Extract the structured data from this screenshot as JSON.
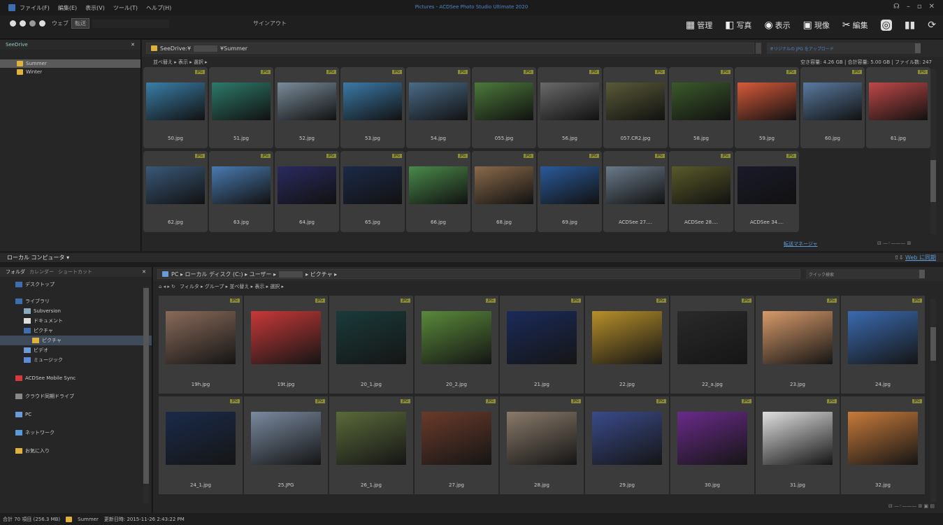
{
  "menu": [
    "ファイル(F)",
    "編集(E)",
    "表示(V)",
    "ツール(T)",
    "ヘルプ(H)"
  ],
  "window_title": "Pictures - ACDSee Photo Studio Ultimate 2020",
  "toolbar": {
    "web": "ウェブ",
    "transfer": "転送",
    "signout": "サインアウト"
  },
  "modes": [
    {
      "label": "管理",
      "icon": "▦"
    },
    {
      "label": "写真",
      "icon": "◧"
    },
    {
      "label": "表示",
      "icon": "◉"
    },
    {
      "label": "現像",
      "icon": "▣"
    },
    {
      "label": "編集",
      "icon": "✂"
    }
  ],
  "top": {
    "panel_title": "SeeDrive",
    "tree": [
      {
        "label": "Summer"
      },
      {
        "label": "Winter"
      }
    ],
    "path_prefix": "SeeDrive:¥",
    "path_suffix": "¥Summer",
    "search_placeholder": "オリジナルの JPG をアップロード",
    "filters": "並べ替え ▸  表示 ▸  選択 ▸",
    "stats": "空き容量: 4.26 GB  |  合計容量: 5.00 GB  |  ファイル数: 247",
    "transfer_manager": "転送マネージャ",
    "files": [
      "50.jpg",
      "51.jpg",
      "52.jpg",
      "53.jpg",
      "54.jpg",
      "055.jpg",
      "56.jpg",
      "057.CR2.jpg",
      "58.jpg",
      "59.jpg",
      "60.jpg",
      "61.jpg",
      "62.jpg",
      "63.jpg",
      "64.jpg",
      "65.jpg",
      "66.jpg",
      "68.jpg",
      "69.jpg",
      "ACDSee 27....",
      "ACDSee 28....",
      "ACDSee 34...."
    ],
    "colors": [
      "#3b7fa8",
      "#2d7a6a",
      "#7a8c9a",
      "#3c7aa8",
      "#4a6b88",
      "#4c7a3a",
      "#6a6a6a",
      "#5a5a38",
      "#3b5a2b",
      "#d85a3a",
      "#5a7aa0",
      "#c04848",
      "#3a5878",
      "#4a7ab0",
      "#2a2a60",
      "#1c2a48",
      "#4a8a4a",
      "#8a6a4a",
      "#2a5a9a",
      "#6a7a8a",
      "#5a5a2a",
      "#1a1a2a"
    ]
  },
  "local": {
    "title": "ローカル コンピュータ ▾",
    "sync": "Web に同期",
    "tabs": [
      "フォルダ",
      "カレンダー",
      "ショートカット"
    ],
    "tree": [
      "デスクトップ",
      "ライブラリ",
      "Subversion",
      "ドキュメント",
      "ピクチャ",
      "ピクチャ",
      "ビデオ",
      "ミュージック",
      "ACDSee Mobile Sync",
      "クラウド同期ドライブ",
      "PC",
      "ネットワーク",
      "お気に入り"
    ],
    "crumbs": [
      "PC",
      "ローカル ディスク (C:)",
      "ユーザー",
      "ピクチャ"
    ],
    "search": "クイック検索",
    "filters": "フィルタ ▸  グループ ▸  並べ替え ▸  表示 ▸  選択 ▸",
    "files": [
      "19h.jpg",
      "19t.jpg",
      "20_1.jpg",
      "20_2.jpg",
      "21.jpg",
      "22.jpg",
      "22_a.jpg",
      "23.jpg",
      "24.jpg",
      "24_1.jpg",
      "25.JPG",
      "26_1.jpg",
      "27.jpg",
      "28.jpg",
      "29.jpg",
      "30.jpg",
      "31.jpg",
      "32.jpg"
    ],
    "colors": [
      "#8a6a5a",
      "#c83838",
      "#1a3a3a",
      "#5a8a3a",
      "#1a2a5a",
      "#b8902a",
      "#2a2a2a",
      "#d89a6a",
      "#3a6ab0",
      "#1a2a4a",
      "#7a8aa0",
      "#5a6a3a",
      "#6a3a2a",
      "#8a7a6a",
      "#3a4a8a",
      "#6a2a8a",
      "#e0e0e0",
      "#c87a3a"
    ]
  },
  "status": {
    "total": "合計 70 項目 (256.3 MB)",
    "folder": "Summer",
    "modified": "更新日時: 2015-11-26 2:43:22 PM"
  }
}
